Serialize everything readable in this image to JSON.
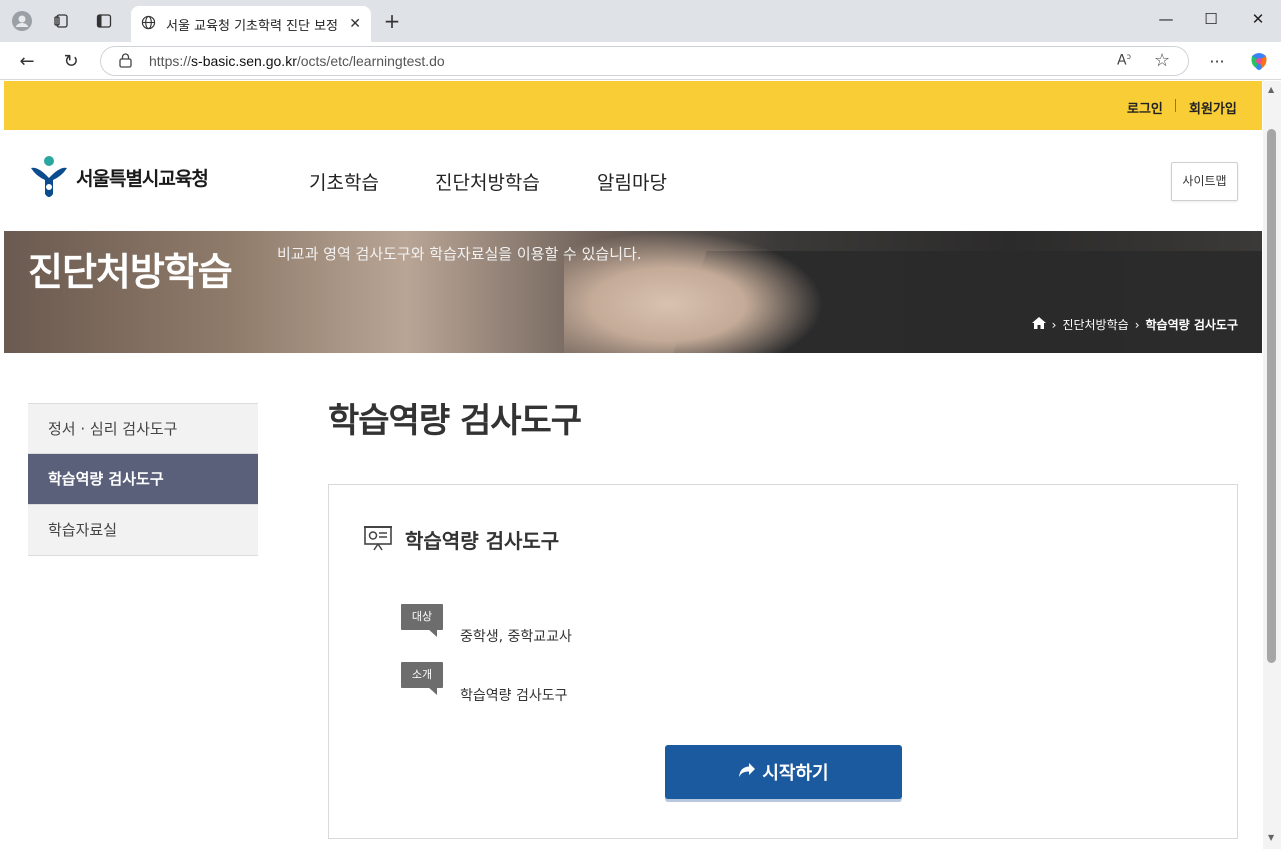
{
  "browser": {
    "tab_title": "서울 교육청 기초학력 진단 보정 ·",
    "url_prefix": "https://",
    "url_host": "s-basic.sen.go.kr",
    "url_path": "/octs/etc/learningtest.do",
    "icons": [
      "profile-icon",
      "collections-icon",
      "tab-actions-icon",
      "globe-icon",
      "close-icon",
      "new-tab-icon",
      "minimize-icon",
      "maximize-icon",
      "window-close-icon",
      "back-icon",
      "refresh-icon",
      "lock-icon",
      "read-aloud-icon",
      "favorite-icon",
      "more-icon",
      "copilot-icon"
    ]
  },
  "topbar": {
    "login": "로그인",
    "signup": "회원가입"
  },
  "header": {
    "logo_text": "서울특별시교육청",
    "nav": [
      "기초학습",
      "진단처방학습",
      "알림마당"
    ],
    "sitemap": "사이트맵"
  },
  "banner": {
    "title": "진단처방학습",
    "description": "비교과 영역 검사도구와 학습자료실을 이용할 수 있습니다.",
    "breadcrumb": [
      "진단처방학습",
      "학습역량 검사도구"
    ]
  },
  "sidebar": {
    "items": [
      {
        "label": "정서 · 심리 검사도구",
        "active": false
      },
      {
        "label": "학습역량 검사도구",
        "active": true
      },
      {
        "label": "학습자료실",
        "active": false
      }
    ]
  },
  "main": {
    "title": "학습역량 검사도구",
    "card": {
      "title": "학습역량 검사도구",
      "target_tag": "대상",
      "target_value": "중학생, 중학교교사",
      "intro_tag": "소개",
      "intro_value": "학습역량 검사도구",
      "start_button": "시작하기"
    }
  },
  "colors": {
    "topbar": "#f8cd35",
    "active_menu": "#5a607a",
    "primary_button": "#1c5aa0"
  }
}
